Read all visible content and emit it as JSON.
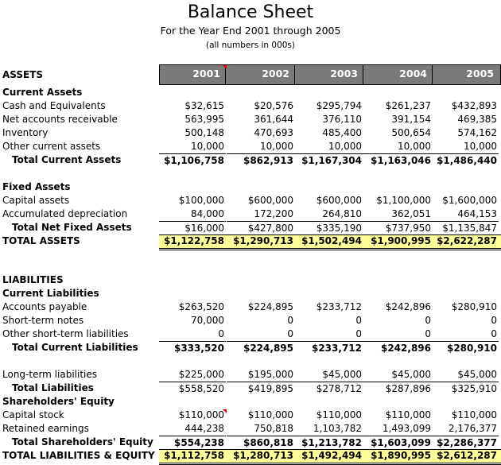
{
  "header": {
    "title": "Balance Sheet",
    "subtitle": "For the Year End 2001 through 2005",
    "note": "(all numbers in 000s)"
  },
  "columns": {
    "section_label": "ASSETS",
    "years": [
      "2001",
      "2002",
      "2003",
      "2004",
      "2005"
    ]
  },
  "colors": {
    "header_bg": "#7a7a7a",
    "header_text": "#ffffff",
    "highlight": "#ffff99",
    "comment_marker": "#e00000"
  },
  "assets": {
    "current": {
      "heading": "Current Assets",
      "rows": [
        {
          "label": "Cash and Equivalents",
          "values": [
            "$32,615",
            "$20,576",
            "$295,794",
            "$261,237",
            "$432,893"
          ]
        },
        {
          "label": "Net accounts receivable",
          "values": [
            "563,995",
            "361,644",
            "376,110",
            "391,154",
            "469,385"
          ]
        },
        {
          "label": "Inventory",
          "values": [
            "500,148",
            "470,693",
            "485,400",
            "500,654",
            "574,162"
          ]
        },
        {
          "label": "Other current assets",
          "values": [
            "10,000",
            "10,000",
            "10,000",
            "10,000",
            "10,000"
          ]
        }
      ],
      "total": {
        "label": "Total Current Assets",
        "values": [
          "$1,106,758",
          "$862,913",
          "$1,167,304",
          "$1,163,046",
          "$1,486,440"
        ]
      }
    },
    "fixed": {
      "heading": "Fixed Assets",
      "rows": [
        {
          "label": "Capital assets",
          "values": [
            "$100,000",
            "$600,000",
            "$600,000",
            "$1,100,000",
            "$1,600,000"
          ]
        },
        {
          "label": "Accumulated depreciation",
          "values": [
            "84,000",
            "172,200",
            "264,810",
            "362,051",
            "464,153"
          ]
        }
      ],
      "total": {
        "label": "Total Net Fixed Assets",
        "values": [
          "$16,000",
          "$427,800",
          "$335,190",
          "$737,950",
          "$1,135,847"
        ]
      }
    },
    "grand_total": {
      "label": "TOTAL ASSETS",
      "values": [
        "$1,122,758",
        "$1,290,713",
        "$1,502,494",
        "$1,900,995",
        "$2,622,287"
      ]
    }
  },
  "liabilities": {
    "heading": "LIABILITIES",
    "current": {
      "heading": "Current Liabilities",
      "rows": [
        {
          "label": "Accounts payable",
          "values": [
            "$263,520",
            "$224,895",
            "$233,712",
            "$242,896",
            "$280,910"
          ]
        },
        {
          "label": "Short-term notes",
          "values": [
            "70,000",
            "0",
            "0",
            "0",
            "0"
          ]
        },
        {
          "label": "Other short-term liabilities",
          "values": [
            "0",
            "0",
            "0",
            "0",
            "0"
          ]
        }
      ],
      "total": {
        "label": "Total Current Liabilities",
        "values": [
          "$333,520",
          "$224,895",
          "$233,712",
          "$242,896",
          "$280,910"
        ]
      }
    },
    "long_term": {
      "label": "Long-term liabilities",
      "values": [
        "$225,000",
        "$195,000",
        "$45,000",
        "$45,000",
        "$45,000"
      ]
    },
    "total": {
      "label": "Total Liabilities",
      "values": [
        "$558,520",
        "$419,895",
        "$278,712",
        "$287,896",
        "$325,910"
      ]
    }
  },
  "equity": {
    "heading": "Shareholders' Equity",
    "rows": [
      {
        "label": "Capital stock",
        "values": [
          "$110,000",
          "$110,000",
          "$110,000",
          "$110,000",
          "$110,000"
        ]
      },
      {
        "label": "Retained earnings",
        "values": [
          "444,238",
          "750,818",
          "1,103,782",
          "1,493,099",
          "2,176,377"
        ]
      }
    ],
    "total": {
      "label": "Total Shareholders' Equity",
      "values": [
        "$554,238",
        "$860,818",
        "$1,213,782",
        "$1,603,099",
        "$2,286,377"
      ]
    }
  },
  "grand_total": {
    "label": "TOTAL LIABILITIES & EQUITY",
    "values": [
      "$1,112,758",
      "$1,280,713",
      "$1,492,494",
      "$1,890,995",
      "$2,612,287"
    ]
  }
}
